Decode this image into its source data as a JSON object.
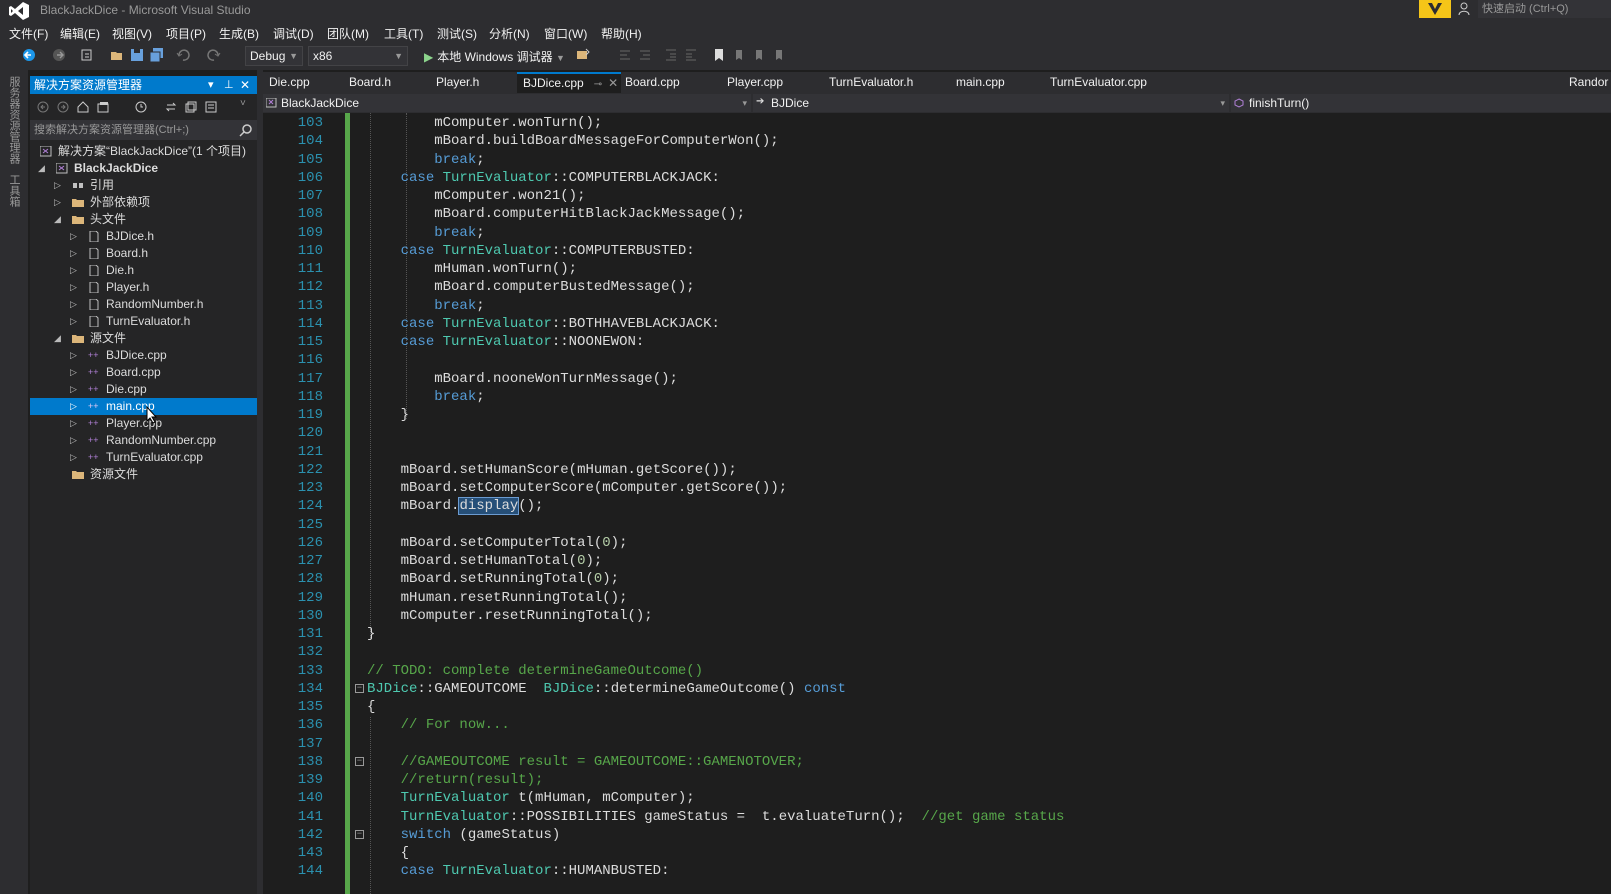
{
  "window": {
    "title": "BlackJackDice - Microsoft Visual Studio",
    "quick_launch": "快速启动 (Ctrl+Q)"
  },
  "menu": [
    "文件(F)",
    "编辑(E)",
    "视图(V)",
    "项目(P)",
    "生成(B)",
    "调试(D)",
    "团队(M)",
    "工具(T)",
    "测试(S)",
    "分析(N)",
    "窗口(W)",
    "帮助(H)"
  ],
  "toolbar": {
    "config": "Debug",
    "platform": "x86",
    "run_label": "本地 Windows 调试器"
  },
  "left_strip_tabs": [
    "服务器资源管理器",
    "工具箱"
  ],
  "solution_explorer": {
    "title": "解决方案资源管理器",
    "search_placeholder": "搜索解决方案资源管理器(Ctrl+;)",
    "items": [
      {
        "label": "解决方案“BlackJackDice”(1 个项目)",
        "icon": "solution-icon"
      },
      {
        "label": "BlackJackDice",
        "icon": "project-icon",
        "bold": true
      },
      {
        "label": "引用",
        "icon": "references-icon"
      },
      {
        "label": "外部依赖项",
        "icon": "folder-icon"
      },
      {
        "label": "头文件",
        "icon": "folder-icon"
      },
      {
        "label": "BJDice.h",
        "icon": "header-file-icon"
      },
      {
        "label": "Board.h",
        "icon": "header-file-icon"
      },
      {
        "label": "Die.h",
        "icon": "header-file-icon"
      },
      {
        "label": "Player.h",
        "icon": "header-file-icon"
      },
      {
        "label": "RandomNumber.h",
        "icon": "header-file-icon"
      },
      {
        "label": "TurnEvaluator.h",
        "icon": "header-file-icon"
      },
      {
        "label": "源文件",
        "icon": "folder-icon"
      },
      {
        "label": "BJDice.cpp",
        "icon": "cpp-file-icon"
      },
      {
        "label": "Board.cpp",
        "icon": "cpp-file-icon"
      },
      {
        "label": "Die.cpp",
        "icon": "cpp-file-icon"
      },
      {
        "label": "main.cpp",
        "icon": "cpp-file-icon",
        "selected": true
      },
      {
        "label": "Player.cpp",
        "icon": "cpp-file-icon"
      },
      {
        "label": "RandomNumber.cpp",
        "icon": "cpp-file-icon"
      },
      {
        "label": "TurnEvaluator.cpp",
        "icon": "cpp-file-icon"
      },
      {
        "label": "资源文件",
        "icon": "folder-icon"
      }
    ]
  },
  "tabs": [
    "Die.cpp",
    "Board.h",
    "Player.h",
    "BJDice.cpp",
    "Board.cpp",
    "Player.cpp",
    "TurnEvaluator.h",
    "main.cpp",
    "TurnEvaluator.cpp",
    "Randor"
  ],
  "active_tab": "BJDice.cpp",
  "nav": {
    "project": "BlackJackDice",
    "scope": "BJDice",
    "member": "finishTurn()"
  },
  "code_lines": [
    {
      "n": "103",
      "t": "        mComputer.wonTurn();"
    },
    {
      "n": "104",
      "t": "        mBoard.buildBoardMessageForComputerWon();"
    },
    {
      "n": "105",
      "t": "        break;"
    },
    {
      "n": "106",
      "t": "    case TurnEvaluator::COMPUTERBLACKJACK:"
    },
    {
      "n": "107",
      "t": "        mComputer.won21();"
    },
    {
      "n": "108",
      "t": "        mBoard.computerHitBlackJackMessage();"
    },
    {
      "n": "109",
      "t": "        break;"
    },
    {
      "n": "110",
      "t": "    case TurnEvaluator::COMPUTERBUSTED:"
    },
    {
      "n": "111",
      "t": "        mHuman.wonTurn();"
    },
    {
      "n": "112",
      "t": "        mBoard.computerBustedMessage();"
    },
    {
      "n": "113",
      "t": "        break;"
    },
    {
      "n": "114",
      "t": "    case TurnEvaluator::BOTHHAVEBLACKJACK:"
    },
    {
      "n": "115",
      "t": "    case TurnEvaluator::NOONEWON:"
    },
    {
      "n": "116",
      "t": ""
    },
    {
      "n": "117",
      "t": "        mBoard.nooneWonTurnMessage();"
    },
    {
      "n": "118",
      "t": "        break;"
    },
    {
      "n": "119",
      "t": "    }"
    },
    {
      "n": "120",
      "t": ""
    },
    {
      "n": "121",
      "t": ""
    },
    {
      "n": "122",
      "t": "    mBoard.setHumanScore(mHuman.getScore());"
    },
    {
      "n": "123",
      "t": "    mBoard.setComputerScore(mComputer.getScore());"
    },
    {
      "n": "124",
      "t": "    mBoard.display();"
    },
    {
      "n": "125",
      "t": ""
    },
    {
      "n": "126",
      "t": "    mBoard.setComputerTotal(0);"
    },
    {
      "n": "127",
      "t": "    mBoard.setHumanTotal(0);"
    },
    {
      "n": "128",
      "t": "    mBoard.setRunningTotal(0);"
    },
    {
      "n": "129",
      "t": "    mHuman.resetRunningTotal();"
    },
    {
      "n": "130",
      "t": "    mComputer.resetRunningTotal();"
    },
    {
      "n": "131",
      "t": "}"
    },
    {
      "n": "132",
      "t": ""
    },
    {
      "n": "133",
      "t": "// TODO: complete determineGameOutcome()"
    },
    {
      "n": "134",
      "t": "BJDice::GAMEOUTCOME  BJDice::determineGameOutcome() const"
    },
    {
      "n": "135",
      "t": "{"
    },
    {
      "n": "136",
      "t": "    // For now..."
    },
    {
      "n": "137",
      "t": ""
    },
    {
      "n": "138",
      "t": "    //GAMEOUTCOME result = GAMEOUTCOME::GAMENOTOVER;"
    },
    {
      "n": "139",
      "t": "    //return(result);"
    },
    {
      "n": "140",
      "t": "    TurnEvaluator t(mHuman, mComputer);"
    },
    {
      "n": "141",
      "t": "    TurnEvaluator::POSSIBILITIES gameStatus =  t.evaluateTurn();  //get game status"
    },
    {
      "n": "142",
      "t": "    switch (gameStatus)"
    },
    {
      "n": "143",
      "t": "    {"
    },
    {
      "n": "144",
      "t": "    case TurnEvaluator::HUMANBUSTED:"
    }
  ],
  "colors": {
    "accent": "#007acc",
    "editor_bg": "#1e1e1e",
    "keyword": "#569cd6",
    "type": "#4ec9b0",
    "comment": "#57a64a",
    "number": "#b5cea8",
    "line_number": "#2b91af"
  }
}
